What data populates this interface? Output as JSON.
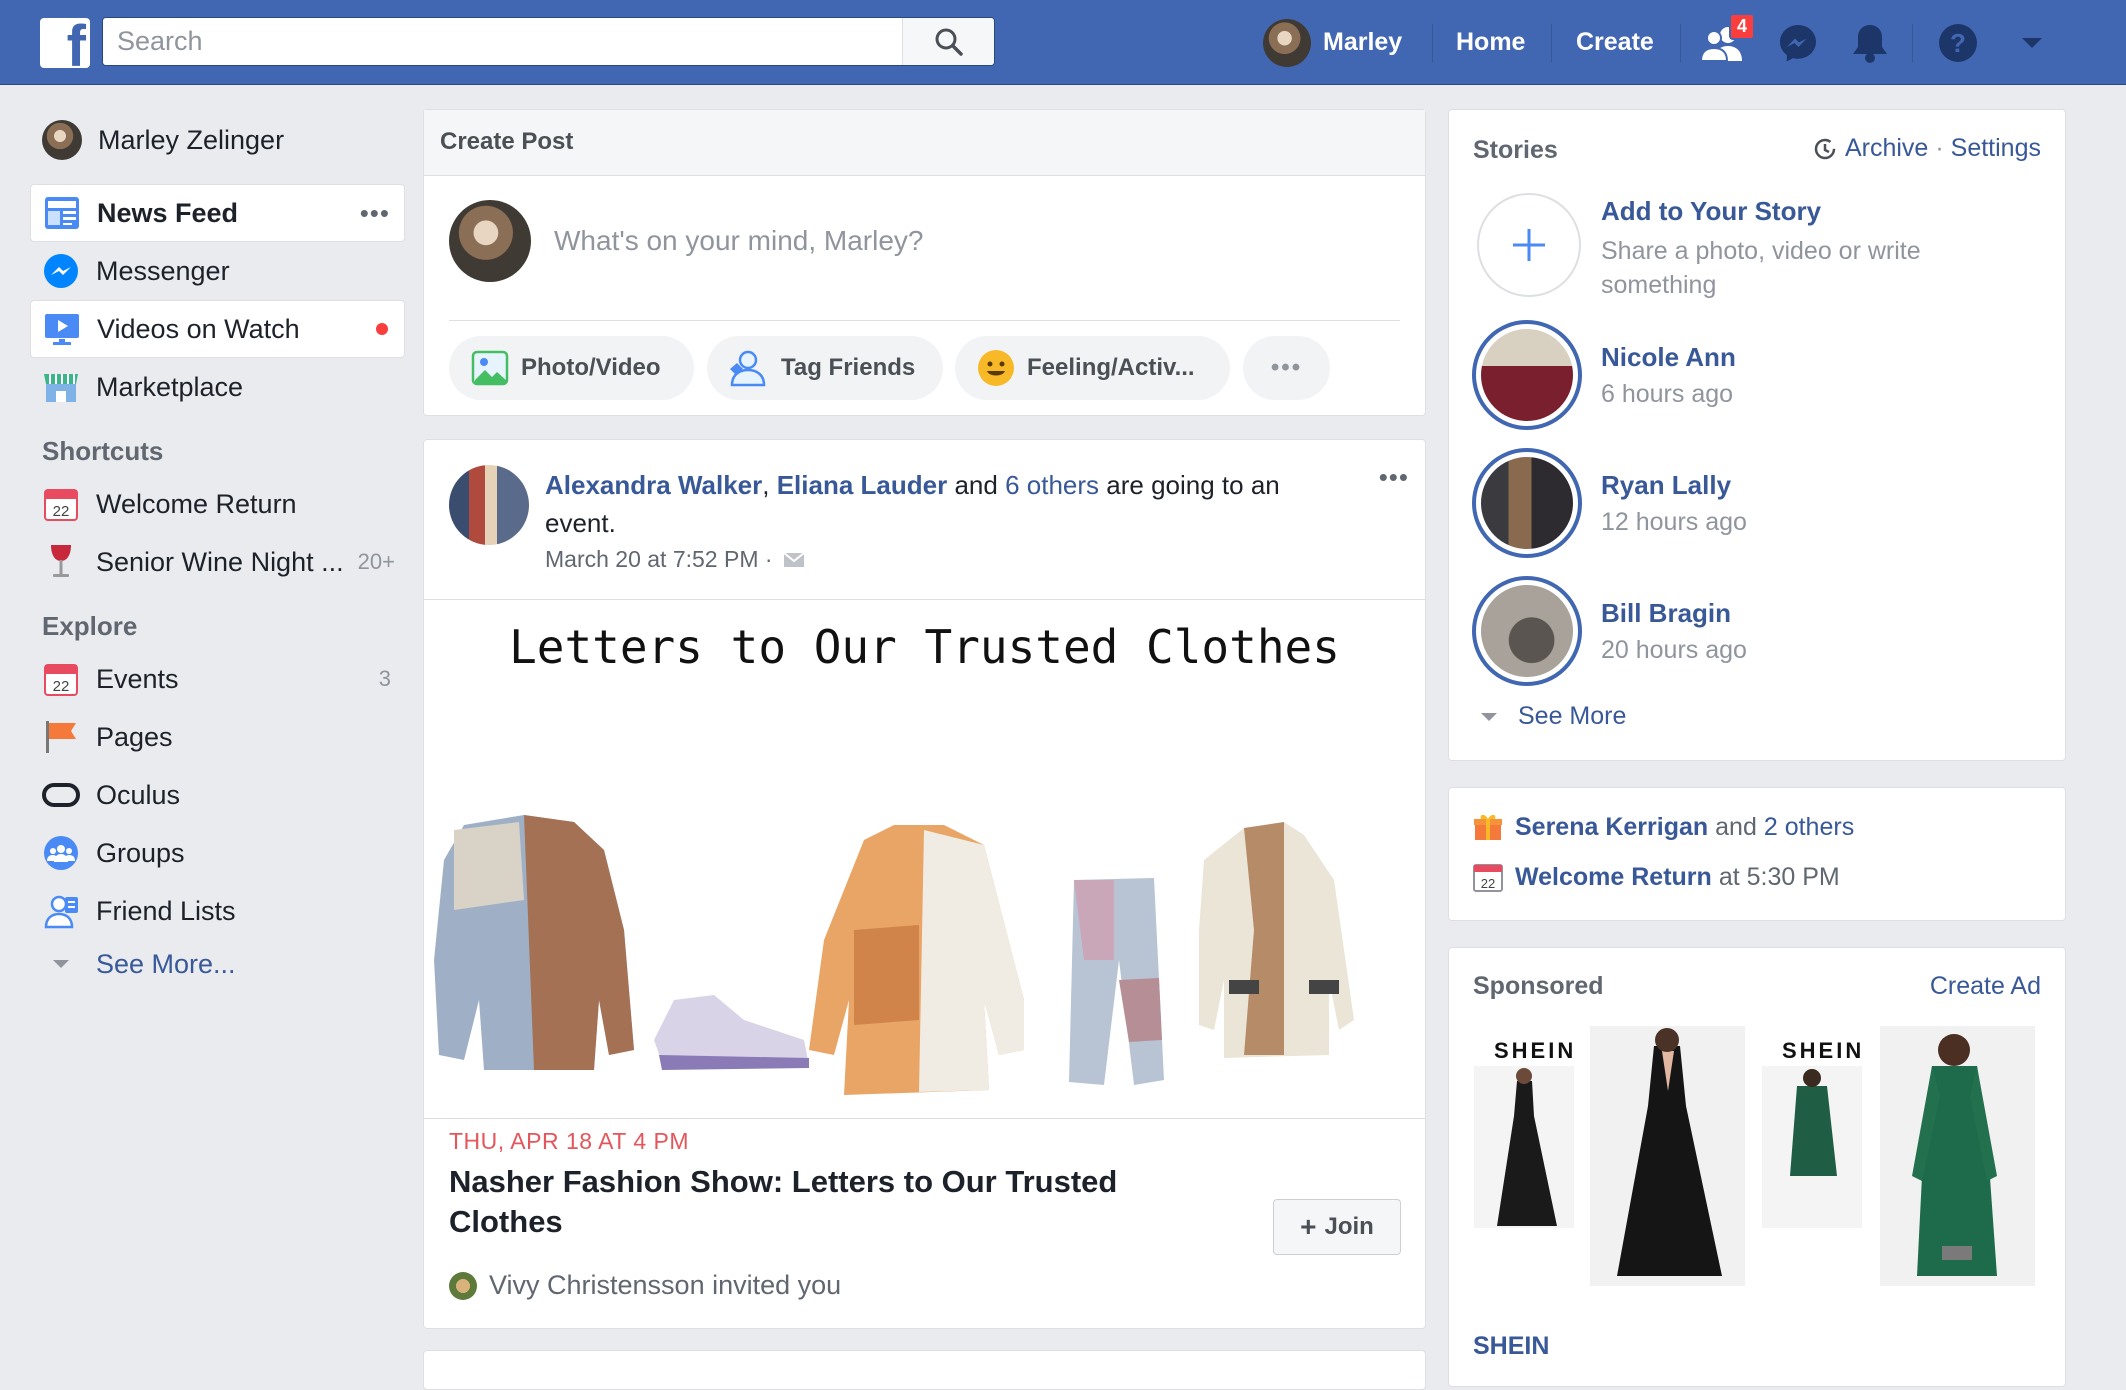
{
  "topbar": {
    "search_placeholder": "Search",
    "user_name": "Marley",
    "home": "Home",
    "create": "Create",
    "friend_requests_count": "4"
  },
  "sidebar": {
    "profile_name": "Marley Zelinger",
    "main": [
      {
        "label": "News Feed",
        "icon": "news-feed-icon"
      },
      {
        "label": "Messenger",
        "icon": "messenger-icon"
      },
      {
        "label": "Videos on Watch",
        "icon": "watch-icon"
      },
      {
        "label": "Marketplace",
        "icon": "marketplace-icon"
      }
    ],
    "shortcuts_header": "Shortcuts",
    "shortcuts": [
      {
        "label": "Welcome Return",
        "icon": "calendar-icon"
      },
      {
        "label": "Senior Wine Night ...",
        "count": "20+",
        "icon": "wine-glass-icon"
      }
    ],
    "explore_header": "Explore",
    "explore": [
      {
        "label": "Events",
        "count": "3",
        "icon": "calendar-icon"
      },
      {
        "label": "Pages",
        "icon": "flag-icon"
      },
      {
        "label": "Oculus",
        "icon": "oculus-icon"
      },
      {
        "label": "Groups",
        "icon": "groups-icon"
      },
      {
        "label": "Friend Lists",
        "icon": "friend-list-icon"
      }
    ],
    "see_more": "See More..."
  },
  "create_post": {
    "header": "Create Post",
    "placeholder": "What's on your mind, Marley?",
    "actions": [
      "Photo/Video",
      "Tag Friends",
      "Feeling/Activ..."
    ]
  },
  "post": {
    "author1": "Alexandra Walker",
    "comma": ",",
    "author2": "Eliana Lauder",
    "and": "and",
    "others": "6 others",
    "action": "are going to an event.",
    "timestamp": "March 20 at 7:52 PM ·",
    "poster_title": "Letters to Our Trusted Clothes",
    "event_date": "THU, APR 18 AT 4 PM",
    "event_title": "Nasher Fashion Show: Letters to Our Trusted Clothes",
    "join_label": "Join",
    "invited": "Vivy Christensson invited you"
  },
  "stories": {
    "header": "Stories",
    "archive": "Archive",
    "dot": "·",
    "settings": "Settings",
    "add_title": "Add to Your Story",
    "add_sub": "Share a photo, video or write something",
    "items": [
      {
        "name": "Nicole Ann",
        "time": "6 hours ago"
      },
      {
        "name": "Ryan Lally",
        "time": "12 hours ago"
      },
      {
        "name": "Bill Bragin",
        "time": "20 hours ago"
      }
    ],
    "see_more": "See More"
  },
  "birthdays": {
    "name": "Serena Kerrigan",
    "and": "and",
    "others": "2 others",
    "event": "Welcome Return",
    "event_time": "at 5:30 PM"
  },
  "sponsored": {
    "header": "Sponsored",
    "create_ad": "Create Ad",
    "brand_logo_1": "SHEIN",
    "brand_logo_2": "SHEIN",
    "advertiser": "SHEIN"
  }
}
